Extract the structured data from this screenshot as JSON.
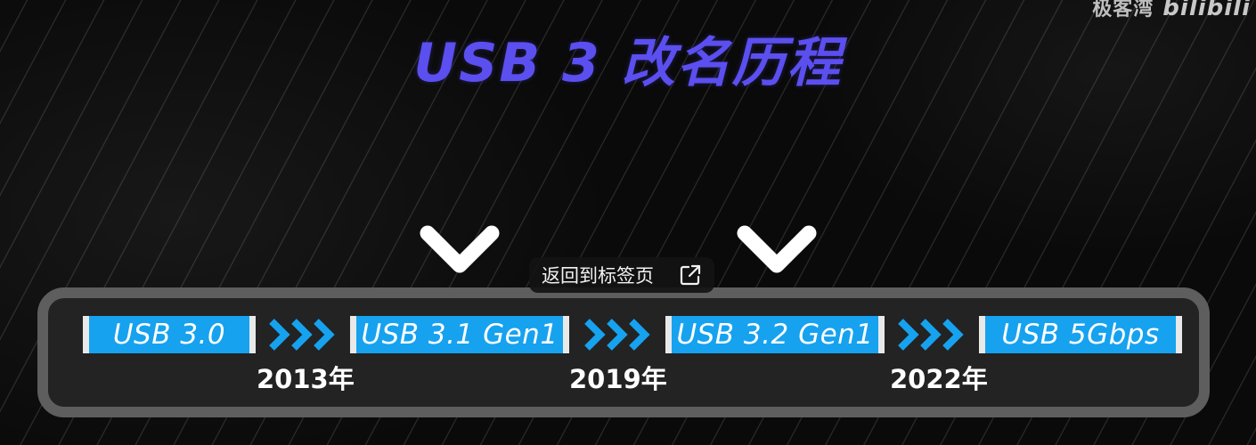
{
  "watermark": {
    "text": "极客湾",
    "logo": "bilibili"
  },
  "title": "USB 3 改名历程",
  "tooltip": {
    "label": "返回到标签页",
    "icon": "open-external-icon"
  },
  "markers": [
    "chevron-down-icon",
    "chevron-down-icon"
  ],
  "timeline": {
    "stages": [
      {
        "label": "USB 3.0"
      },
      {
        "label": "USB 3.1 Gen1"
      },
      {
        "label": "USB 3.2 Gen1"
      },
      {
        "label": "USB 5Gbps"
      }
    ],
    "years": [
      "2013年",
      "2019年",
      "2022年"
    ]
  },
  "colors": {
    "title": "#5b4ff0",
    "stage_fill": "#16a2ef",
    "stage_edge": "#e9e9e9",
    "chevron": "#16a2ef",
    "frame": "#5e5e5e",
    "frame_fill": "#232323"
  }
}
